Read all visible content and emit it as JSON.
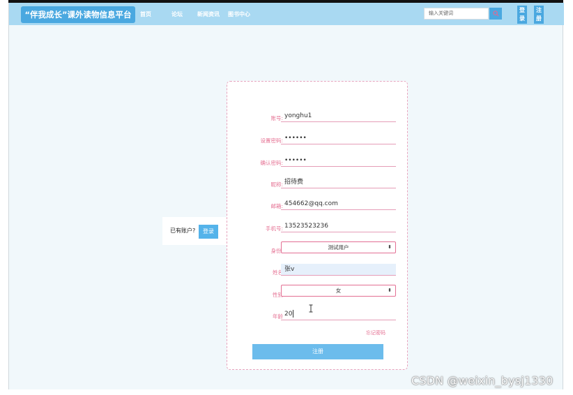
{
  "header": {
    "brand": "“伴我成长”课外读物信息平台",
    "nav": [
      "首页",
      "论坛",
      "新闻资讯",
      "图书中心"
    ],
    "search_placeholder": "输入关键词",
    "login_label": "登录",
    "register_label": "注册"
  },
  "side": {
    "have_account": "已有账户?",
    "login_button": "登录"
  },
  "form": {
    "fields": [
      {
        "label": "账号:",
        "value": "yonghu1"
      },
      {
        "label": "设置密码:",
        "value": "••••••"
      },
      {
        "label": "确认密码:",
        "value": "••••••"
      },
      {
        "label": "昵称:",
        "value": "招待费"
      },
      {
        "label": "邮箱:",
        "value": "454662@qq.com"
      },
      {
        "label": "手机号:",
        "value": "13523523236"
      }
    ],
    "identity": {
      "label": "身份:",
      "value": "测试用户"
    },
    "name": {
      "label": "姓名",
      "value": "张v"
    },
    "gender": {
      "label": "性别",
      "value": "女"
    },
    "age": {
      "label": "年龄",
      "value": "20"
    },
    "forgot": "忘记密码",
    "submit": "注册"
  },
  "watermark": "CSDN @weixin_bysj1330",
  "colors": {
    "nav_bg": "#a9d9f2",
    "accent": "#4aa8e0",
    "label_pink": "#e57193"
  }
}
